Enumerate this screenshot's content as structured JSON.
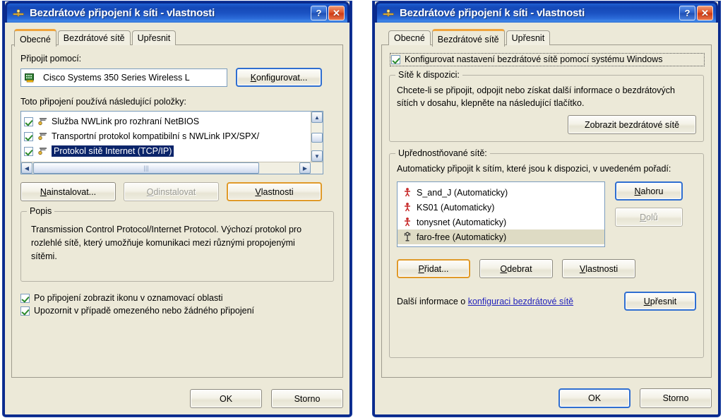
{
  "colors": {
    "titlebar_blue": "#1549B8",
    "window_border": "#0A2A8C",
    "dialog_face": "#ECE9D8",
    "active_tab_accent": "#EFA43C",
    "selection_blue": "#0A246A",
    "selection_tan": "#DEDBC4",
    "link_blue": "#2222BB",
    "default_button_blue": "#2F6ED0",
    "focus_button_orange": "#E09A29"
  },
  "left_dialog": {
    "title": "Bezdrátové připojení k síti - vlastnosti",
    "title_icon": "wireless-network-icon",
    "help_button": "?",
    "close_button": "✕",
    "tabs": [
      {
        "label": "Obecné",
        "active": true
      },
      {
        "label": "Bezdrátové sítě",
        "active": false
      },
      {
        "label": "Upřesnit",
        "active": false
      }
    ],
    "connect_using_label": "Připojit pomocí:",
    "adapter": {
      "icon": "network-adapter-icon",
      "name": "Cisco Systems 350 Series Wireless L"
    },
    "configure_button": "Konfigurovat...",
    "items_label": "Toto připojení používá následující položky:",
    "components": [
      {
        "checked": true,
        "icon": "protocol-icon",
        "name": "Služba NWLink pro rozhraní NetBIOS",
        "selected": false
      },
      {
        "checked": true,
        "icon": "protocol-icon",
        "name": "Transportní protokol kompatibilní s NWLink IPX/SPX/",
        "selected": false
      },
      {
        "checked": true,
        "icon": "protocol-icon",
        "name": "Protokol sítě Internet (TCP/IP)",
        "selected": true
      }
    ],
    "buttons": {
      "install": "Nainstalovat...",
      "install_accel": "N",
      "uninstall": "Odinstalovat",
      "uninstall_accel": "O",
      "uninstall_disabled": true,
      "properties": "Vlastnosti",
      "properties_accel": "V",
      "properties_focused": true
    },
    "description_group_label": "Popis",
    "description_text": "Transmission Control Protocol/Internet Protocol. Výchozí protokol pro rozlehlé sítě, který umožňuje komunikaci mezi různými propojenými sítěmi.",
    "checkboxes": [
      {
        "checked": true,
        "label": "Po připojení zobrazit ikonu v oznamovací oblasti",
        "accel": "P"
      },
      {
        "checked": true,
        "label": "Upozornit v případě omezeného nebo žádného připojení",
        "accel": "m"
      }
    ],
    "footer": {
      "ok": "OK",
      "cancel": "Storno"
    }
  },
  "right_dialog": {
    "title": "Bezdrátové připojení k síti - vlastnosti",
    "title_icon": "wireless-network-icon",
    "help_button": "?",
    "close_button": "✕",
    "tabs": [
      {
        "label": "Obecné",
        "active": false
      },
      {
        "label": "Bezdrátové sítě",
        "active": true
      },
      {
        "label": "Upřesnit",
        "active": false
      }
    ],
    "use_windows_checkbox": {
      "checked": true,
      "label": "Konfigurovat nastavení bezdrátové sítě pomocí systému Windows",
      "focused": true
    },
    "available_group": {
      "legend": "Sítě k dispozici:",
      "text": "Chcete-li se připojit, odpojit nebo získat další informace o bezdrátových sítích v dosahu, klepněte na následující tlačítko.",
      "button": "Zobrazit bezdrátové sítě"
    },
    "preferred_group": {
      "legend": "Upřednostňované sítě:",
      "text": "Automaticky připojit k sítím, které jsou k dispozici, v uvedeném pořadí:",
      "networks": [
        {
          "icon": "wireless-adhoc-icon",
          "name": "S_and_J (Automaticky)",
          "selected": false
        },
        {
          "icon": "wireless-adhoc-icon",
          "name": "KS01 (Automaticky)",
          "selected": false
        },
        {
          "icon": "wireless-adhoc-icon",
          "name": "tonysnet (Automaticky)",
          "selected": false
        },
        {
          "icon": "wireless-ap-icon",
          "name": "faro-free (Automaticky)",
          "selected": true
        }
      ],
      "move_up": "Nahoru",
      "move_up_accel": "N",
      "move_down": "Dolů",
      "move_down_accel": "D",
      "move_down_disabled": true,
      "add": "Přidat...",
      "add_accel": "P",
      "add_focused": true,
      "remove": "Odebrat",
      "remove_accel": "O",
      "properties": "Vlastnosti",
      "properties_accel": "V",
      "info_prefix": "Další informace o ",
      "info_link": "konfiguraci bezdrátové sítě",
      "advanced": "Upřesnit",
      "advanced_accel": "U"
    },
    "footer": {
      "ok": "OK",
      "cancel": "Storno"
    }
  }
}
